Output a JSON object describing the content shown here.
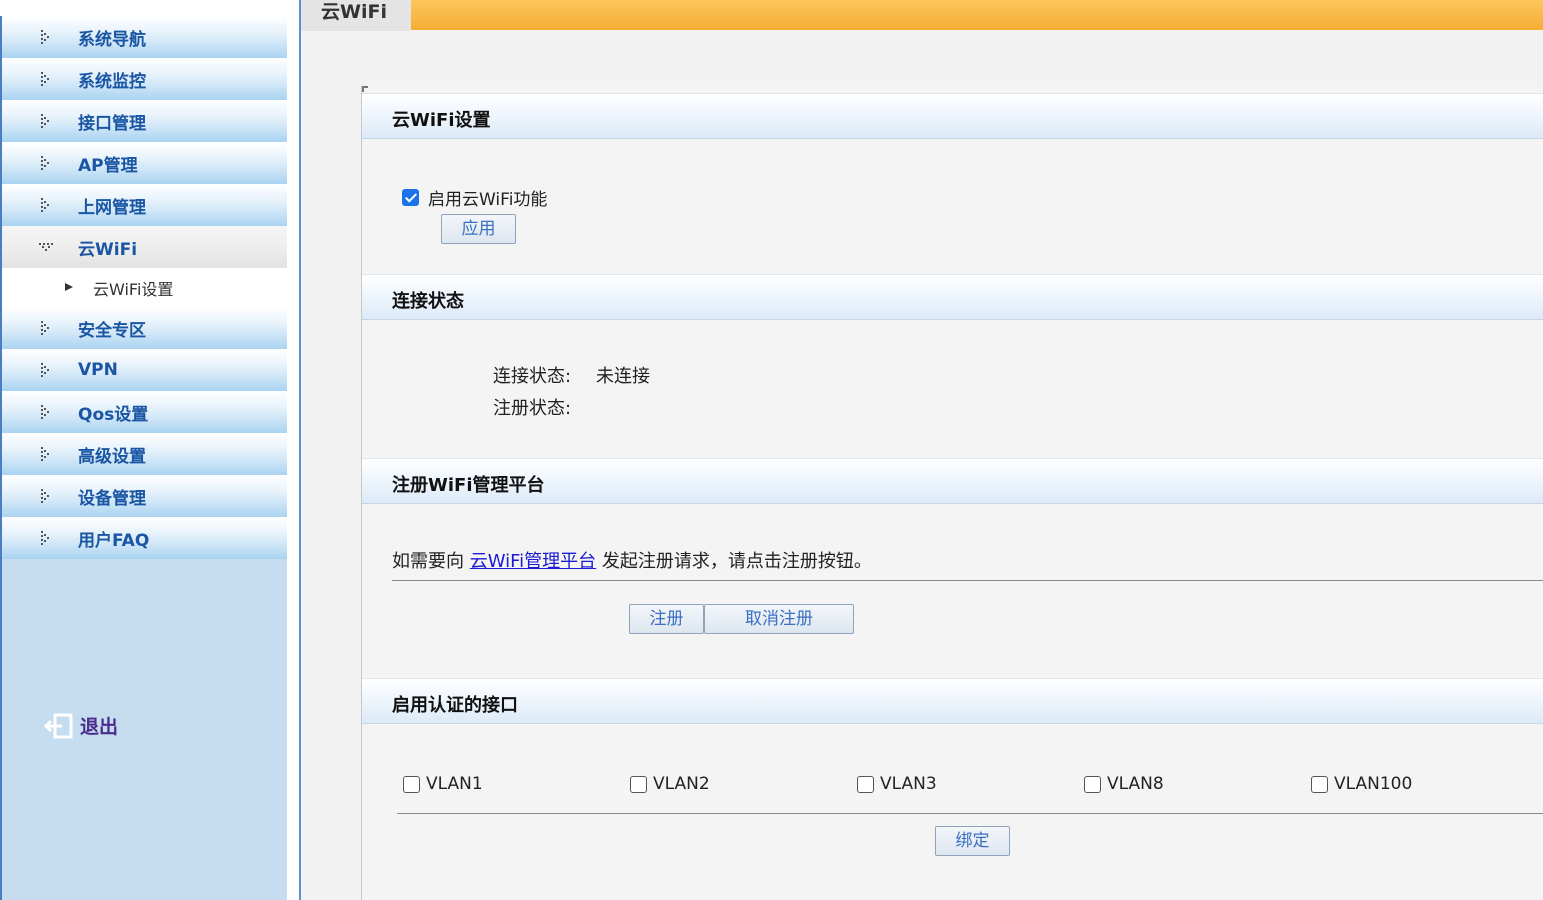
{
  "sidebar": {
    "items": [
      {
        "label": "系统导航"
      },
      {
        "label": "系统监控"
      },
      {
        "label": "接口管理"
      },
      {
        "label": "AP管理"
      },
      {
        "label": "上网管理"
      },
      {
        "label": "云WiFi",
        "active": true
      },
      {
        "label": "安全专区"
      },
      {
        "label": "VPN"
      },
      {
        "label": "Qos设置"
      },
      {
        "label": "高级设置"
      },
      {
        "label": "设备管理"
      },
      {
        "label": "用户FAQ"
      }
    ],
    "sub_item": {
      "label": "云WiFi设置"
    },
    "logout_label": "退出"
  },
  "header": {
    "tab": "云WiFi"
  },
  "sections": {
    "settings": {
      "title": "云WiFi设置",
      "enable_label": "启用云WiFi功能",
      "enable_checked": true,
      "apply_button": "应用"
    },
    "status": {
      "title": "连接状态",
      "connection_label": "连接状态:",
      "connection_value": "未连接",
      "register_label": "注册状态:",
      "register_value": ""
    },
    "register": {
      "title": "注册WiFi管理平台",
      "text_before": "如需要向",
      "link_text": "云WiFi管理平台",
      "text_after": "发起注册请求，请点击注册按钮。",
      "register_button": "注册",
      "unregister_button": "取消注册"
    },
    "interfaces": {
      "title": "启用认证的接口",
      "items": [
        {
          "label": "VLAN1",
          "checked": false
        },
        {
          "label": "VLAN2",
          "checked": false
        },
        {
          "label": "VLAN3",
          "checked": false
        },
        {
          "label": "VLAN8",
          "checked": false
        },
        {
          "label": "VLAN100",
          "checked": false
        }
      ],
      "bind_button": "绑定"
    }
  },
  "colors": {
    "topbar": "#f6ad35",
    "sidebar_bg": "#c6dcef",
    "menu_text": "#1a56a4",
    "link": "#1a1ad2"
  }
}
